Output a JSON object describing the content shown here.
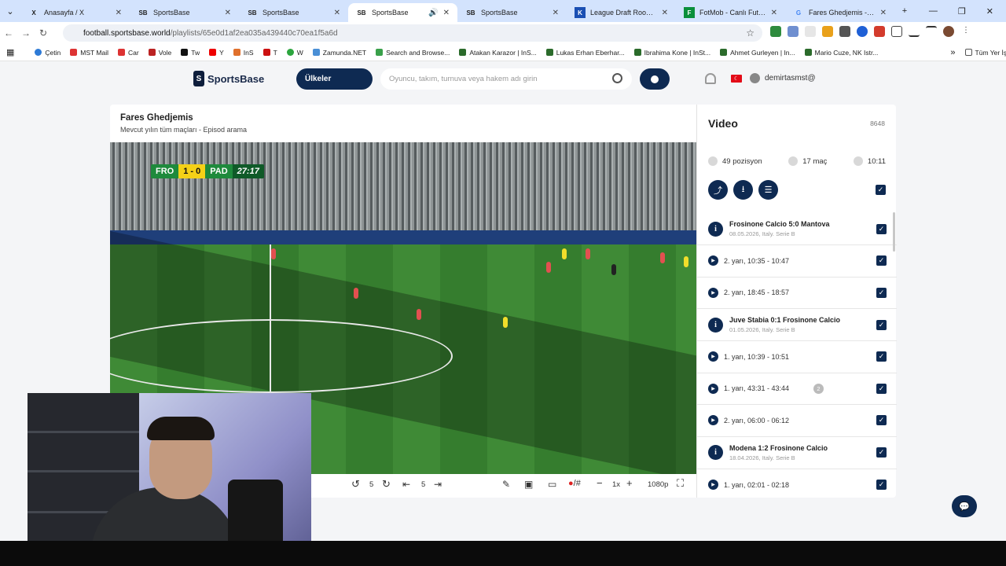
{
  "browser": {
    "tabs": [
      {
        "title": "Anasayfa / X",
        "icon": "x-logo",
        "active": false
      },
      {
        "title": "SportsBase",
        "icon": "sb-logo",
        "active": false
      },
      {
        "title": "SportsBase",
        "icon": "sb-logo",
        "active": false
      },
      {
        "title": "SportsBase",
        "icon": "sb-logo",
        "active": true
      },
      {
        "title": "SportsBase",
        "icon": "sb-logo",
        "active": false
      },
      {
        "title": "League Draft Room - Fant",
        "icon": "league-logo",
        "active": false
      },
      {
        "title": "FotMob - Canlı Futbol Sko",
        "icon": "fotmob-logo",
        "active": false
      },
      {
        "title": "Fares Ghedjemis - Google",
        "icon": "google-logo",
        "active": false
      }
    ],
    "new_tab": "+",
    "url_domain": "football.sportsbase.world",
    "url_path": "/playlists/65e0d1af2ea035a439440c70ea1f5a6d",
    "bookmarks": [
      "Çetin",
      "MST Mail",
      "Car",
      "Vole",
      "Tw",
      "Y",
      "InS",
      "T",
      "W",
      "Zamunda.NET",
      "Search and Browse...",
      "Atakan Karazor | InS...",
      "Lukas Erhan Eberhar...",
      "Ibrahima Kone | InSt...",
      "Ahmet Gurleyen | In...",
      "Mario Cuze, NK Istr..."
    ],
    "all_bookmarks": "Tüm Yer İşaretleri"
  },
  "site": {
    "logo": "SportsBase",
    "countries_btn": "Ülkeler",
    "search_placeholder": "Oyuncu, takım, turnuva veya hakem adı girin",
    "username": "demirtasmst@",
    "flag": "TR"
  },
  "player_card": {
    "title": "Fares Ghedjemis",
    "subtitle": "Mevcut yılın tüm maçları - Episod arama"
  },
  "scoreboard": {
    "home": "FRO",
    "score": "1 - 0",
    "away": "PAD",
    "time": "27:17"
  },
  "controls": {
    "rewind_sec": "5",
    "skip_sec": "5",
    "speed": "1x",
    "quality": "1080p"
  },
  "sidebar": {
    "title": "Video",
    "count": "8648",
    "positions": "49 pozisyon",
    "matches": "17 maç",
    "duration": "10:11",
    "items": [
      {
        "type": "match",
        "title": "Frosinone Calcio 5:0 Mantova",
        "detail": "08.05.2026, Italy. Serie B"
      },
      {
        "type": "clip",
        "label": "2. yarı, 10:35 - 10:47"
      },
      {
        "type": "clip",
        "label": "2. yarı, 18:45 - 18:57"
      },
      {
        "type": "match",
        "title": "Juve Stabia 0:1 Frosinone Calcio",
        "detail": "01.05.2026, Italy. Serie B"
      },
      {
        "type": "clip",
        "label": "1. yarı, 10:39 - 10:51"
      },
      {
        "type": "clip",
        "label": "1. yarı, 43:31 - 43:44",
        "badge": "2"
      },
      {
        "type": "clip",
        "label": "2. yarı, 06:00 - 06:12"
      },
      {
        "type": "match",
        "title": "Modena 1:2 Frosinone Calcio",
        "detail": "18.04.2026, Italy. Serie B"
      },
      {
        "type": "clip",
        "label": "1. yarı, 02:01 - 02:18"
      }
    ]
  },
  "colors": {
    "navy": "#0e2a52",
    "pitch": "#3f8a36",
    "tabbar": "#d3e3fd"
  }
}
